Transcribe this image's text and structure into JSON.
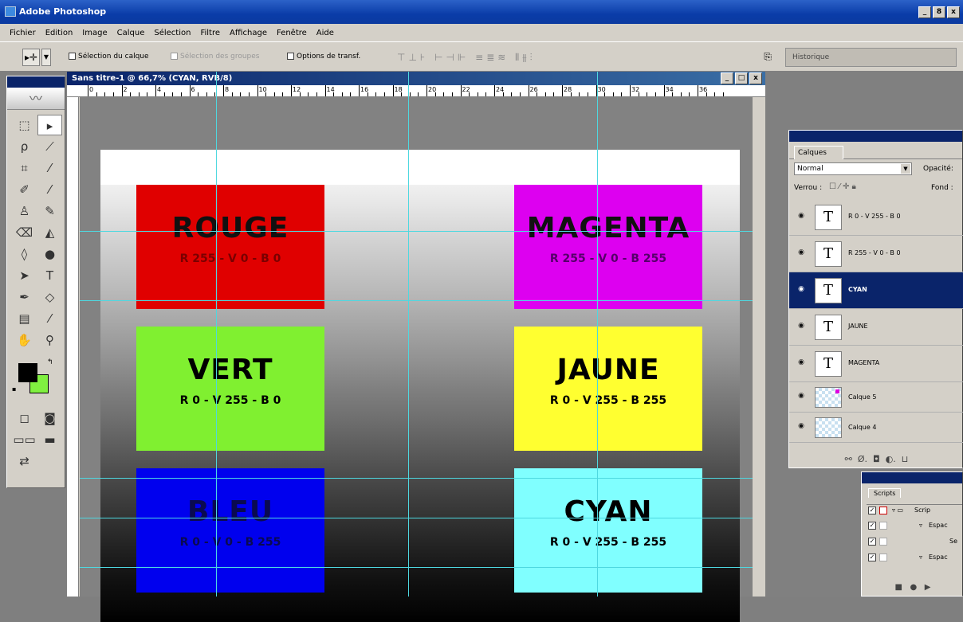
{
  "app": {
    "title": "Adobe Photoshop",
    "controls": [
      "_",
      "8",
      "x"
    ]
  },
  "menu": [
    "Fichier",
    "Edition",
    "Image",
    "Calque",
    "Sélection",
    "Filtre",
    "Affichage",
    "Fenêtre",
    "Aide"
  ],
  "options": {
    "select_layer": "Sélection du calque",
    "select_groups": "Sélection des groupes",
    "transform_options": "Options de transf.",
    "history_tab": "Historique"
  },
  "document": {
    "title": "Sans titre-1 @ 66,7% (CYAN, RVB/8)",
    "controls": [
      "_",
      "□",
      "x"
    ],
    "ruler_numbers": [
      "0",
      "2",
      "4",
      "6",
      "8",
      "10",
      "12",
      "14",
      "16",
      "18",
      "20",
      "22",
      "24",
      "26",
      "28",
      "30",
      "32",
      "34",
      "36"
    ]
  },
  "swatches": [
    {
      "name": "ROUGE",
      "value": "R 255 - V 0 - B 0",
      "color": "#e00000",
      "text_color": "#111111",
      "value_color": "#7a0000"
    },
    {
      "name": "MAGENTA",
      "value": "R 255 - V 0 - B 255",
      "color": "#dd00f0",
      "text_color": "#111111",
      "value_color": "#55006a"
    },
    {
      "name": "VERT",
      "value": "R 0 - V 255 - B 0",
      "color": "#80f030",
      "text_color": "#000000",
      "value_color": "#000000"
    },
    {
      "name": "JAUNE",
      "value": "R 0 - V 255 - B 255",
      "color": "#ffff30",
      "text_color": "#000000",
      "value_color": "#000000"
    },
    {
      "name": "BLEU",
      "value": "R 0 - V 0 - B 255",
      "color": "#0000ee",
      "text_color": "#0a0a50",
      "value_color": "#0a0a50"
    },
    {
      "name": "CYAN",
      "value": "R 0 - V 255 - B 255",
      "color": "#80ffff",
      "text_color": "#000000",
      "value_color": "#000000"
    }
  ],
  "layers_panel": {
    "tab": "Calques",
    "blend_mode": "Normal",
    "opacity_label": "Opacité:",
    "lock_label": "Verrou :",
    "fill_label": "Fond :",
    "layers": [
      {
        "name": "R 0 - V 255 - B 0",
        "type": "text",
        "active": false
      },
      {
        "name": "R 255 - V 0 - B 0",
        "type": "text",
        "active": false
      },
      {
        "name": "CYAN",
        "type": "text",
        "active": true
      },
      {
        "name": "JAUNE",
        "type": "text",
        "active": false
      },
      {
        "name": "MAGENTA",
        "type": "text",
        "active": false
      },
      {
        "name": "Calque 5",
        "type": "raster",
        "active": false
      },
      {
        "name": "Calque 4",
        "type": "raster",
        "active": false
      }
    ]
  },
  "scripts_panel": {
    "tab": "Scripts",
    "rows": [
      "Scrip",
      "Espac",
      "Se",
      "Espac"
    ]
  },
  "colors": {
    "foreground": "#000000",
    "background": "#80f040"
  }
}
